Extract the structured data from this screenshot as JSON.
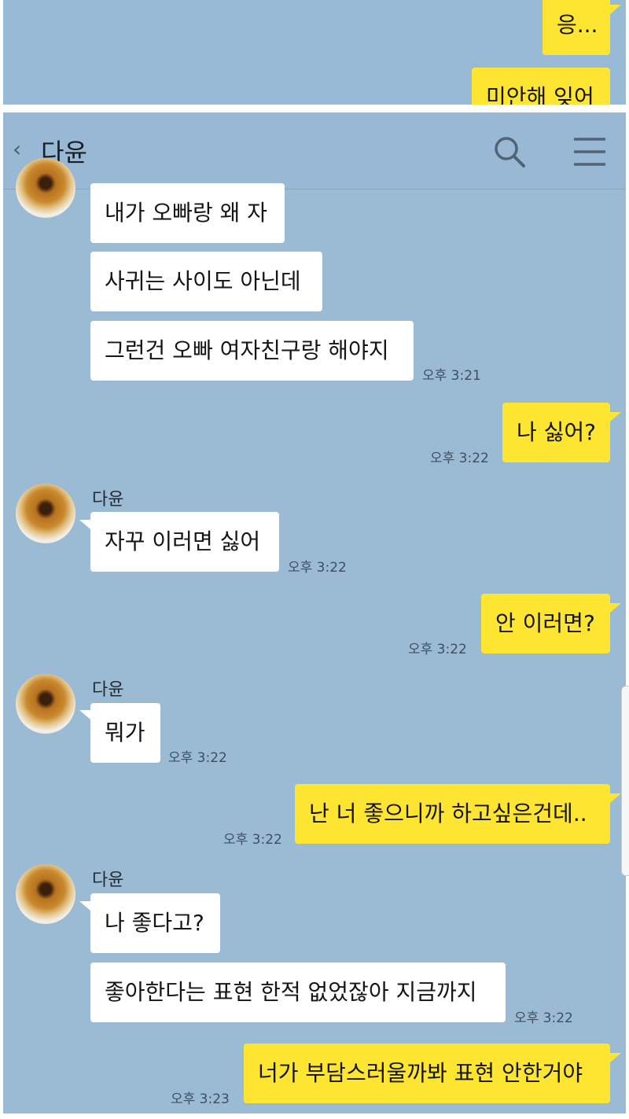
{
  "top_crop": {
    "messages": [
      {
        "text": "응..."
      },
      {
        "text": "미안해 잊어"
      }
    ]
  },
  "header": {
    "back_icon": "chevron-left-icon",
    "title": "다윤",
    "search_icon": "search-icon",
    "menu_icon": "hamburger-menu-icon"
  },
  "messages": [
    {
      "side": "in",
      "text": "내가 오빠랑 왜 자"
    },
    {
      "side": "in",
      "text": "사귀는 사이도 아닌데"
    },
    {
      "side": "in",
      "text": "그런건 오빠 여자친구랑 해야지",
      "time": "오후 3:21"
    },
    {
      "side": "out",
      "text": "나 싫어?",
      "time": "오후 3:22"
    },
    {
      "side": "in",
      "sender": "다윤",
      "text": "자꾸 이러면 싫어",
      "time": "오후 3:22"
    },
    {
      "side": "out",
      "text": "안 이러면?",
      "time": "오후 3:22"
    },
    {
      "side": "in",
      "sender": "다윤",
      "text": "뭐가",
      "time": "오후 3:22"
    },
    {
      "side": "out",
      "text": "난 너 좋으니까 하고싶은건데..",
      "time": "오후 3:22"
    },
    {
      "side": "in",
      "sender": "다윤",
      "text": "나 좋다고?"
    },
    {
      "side": "in",
      "text": "좋아한다는 표현 한적 없었잖아 지금까지",
      "time": "오후 3:22"
    },
    {
      "side": "out",
      "text": "너가 부담스러울까봐 표현 안한거야",
      "time": "오후 3:23"
    }
  ],
  "colors": {
    "background": "#9bbbd4",
    "outgoing_bubble": "#fde532",
    "incoming_bubble": "#ffffff"
  }
}
